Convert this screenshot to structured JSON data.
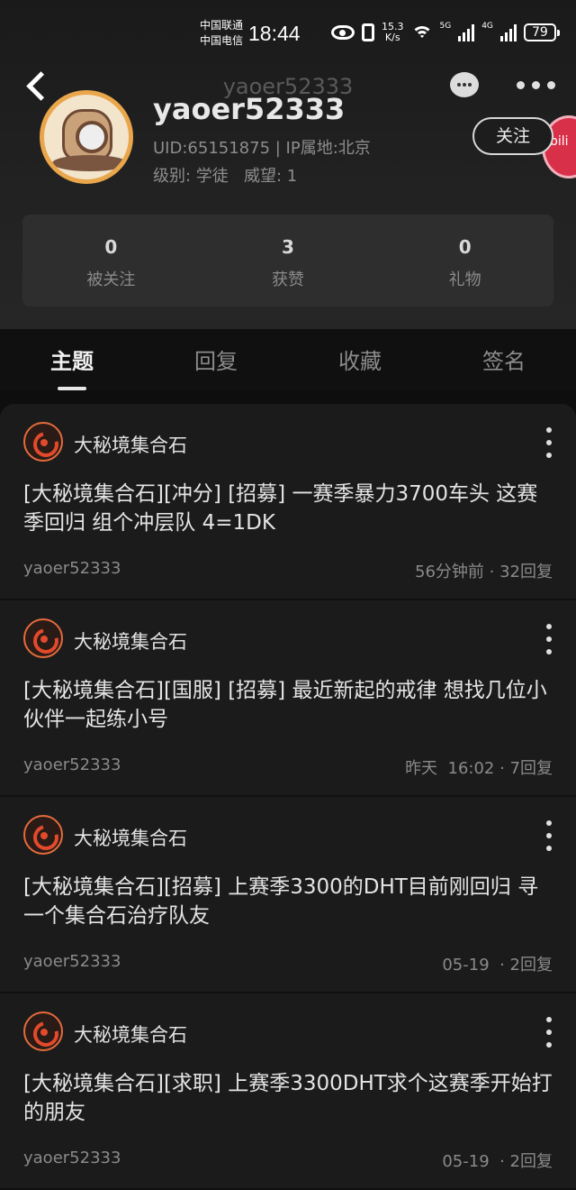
{
  "status_bar": {
    "carrier1": "中国联通",
    "carrier2": "中国电信",
    "time": "18:44",
    "net_speed": "15.3",
    "net_speed_unit": "K/s",
    "net1": "5G",
    "net2": "4G",
    "battery": "79"
  },
  "nav": {
    "title": "yaoer52333"
  },
  "profile": {
    "username": "yaoer52333",
    "uid_line": "UID:65151875 | IP属地:北京",
    "level_line": "级别: 学徒   威望: 1",
    "follow_label": "关注",
    "badge_text": "bili"
  },
  "stats": [
    {
      "value": "0",
      "label": "被关注"
    },
    {
      "value": "3",
      "label": "获赞"
    },
    {
      "value": "0",
      "label": "礼物"
    }
  ],
  "tabs": [
    {
      "label": "主题",
      "active": true
    },
    {
      "label": "回复",
      "active": false
    },
    {
      "label": "收藏",
      "active": false
    },
    {
      "label": "签名",
      "active": false
    }
  ],
  "posts": [
    {
      "forum": "大秘境集合石",
      "title": "[大秘境集合石][冲分] [招募]  一赛季暴力3700车头 这赛季回归 组个冲层队 4=1DK",
      "author": "yaoer52333",
      "meta": "56分钟前 · 32回复"
    },
    {
      "forum": "大秘境集合石",
      "title": "[大秘境集合石][国服] [招募] 最近新起的戒律 想找几位小伙伴一起练小号",
      "author": "yaoer52333",
      "meta": "昨天  16:02 · 7回复"
    },
    {
      "forum": "大秘境集合石",
      "title": "[大秘境集合石][招募] 上赛季3300的DHT目前刚回归 寻一个集合石治疗队友",
      "author": "yaoer52333",
      "meta": "05-19  · 2回复"
    },
    {
      "forum": "大秘境集合石",
      "title": "[大秘境集合石][求职] 上赛季3300DHT求个这赛季开始打的朋友",
      "author": "yaoer52333",
      "meta": "05-19  · 2回复"
    }
  ],
  "colors": {
    "accent_ring": "#e9a64a",
    "forum_logo": "#e24a2b",
    "background": "#1b1b1b"
  },
  "icons": [
    "back-icon",
    "message-icon",
    "more-icon",
    "kebab-icon"
  ]
}
